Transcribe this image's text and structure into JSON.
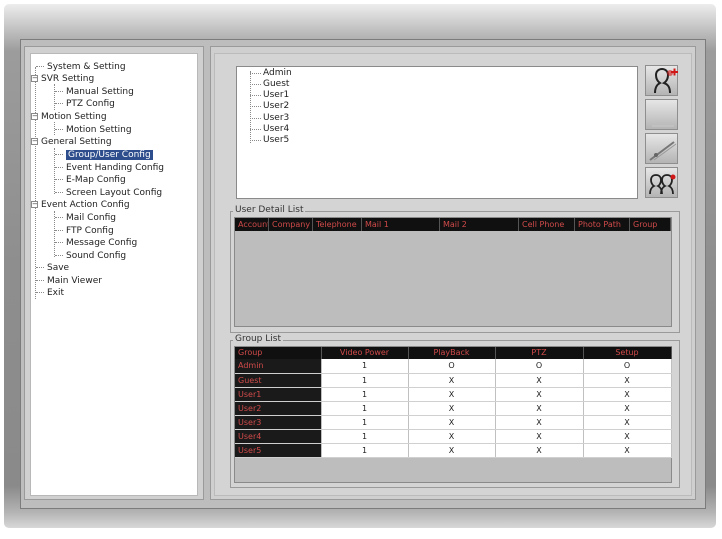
{
  "tree": {
    "items": [
      {
        "label": "System & Setting"
      },
      {
        "label": "SVR Setting"
      },
      {
        "label": "Manual Setting"
      },
      {
        "label": "PTZ Config"
      },
      {
        "label": "Motion Setting"
      },
      {
        "label": "Motion Setting"
      },
      {
        "label": "General Setting"
      },
      {
        "label": "Group/User Config"
      },
      {
        "label": "Event Handing Config"
      },
      {
        "label": "E-Map Config"
      },
      {
        "label": "Screen Layout Config"
      },
      {
        "label": "Event Action Config"
      },
      {
        "label": "Mail Config"
      },
      {
        "label": "FTP Config"
      },
      {
        "label": "Message Config"
      },
      {
        "label": "Sound Config"
      },
      {
        "label": "Save"
      },
      {
        "label": "Main Viewer"
      },
      {
        "label": "Exit"
      }
    ],
    "expand_symbol": "−",
    "selected": "Group/User Config"
  },
  "users": [
    "Admin",
    "Guest",
    "User1",
    "User2",
    "User3",
    "User4",
    "User5"
  ],
  "side_buttons": [
    {
      "icon": "add-user-icon"
    },
    {
      "icon": "blank-icon"
    },
    {
      "icon": "remove-user-icon"
    },
    {
      "icon": "group-users-icon"
    }
  ],
  "user_detail": {
    "title": "User Detail List",
    "columns": [
      "Account",
      "Company",
      "Telephone",
      "Mail 1",
      "Mail 2",
      "Cell Phone",
      "Photo Path",
      "Group"
    ]
  },
  "group_list": {
    "title": "Group List",
    "columns": [
      "Group",
      "Video Power",
      "PlayBack",
      "PTZ",
      "Setup"
    ],
    "rows": [
      [
        "Admin",
        "1",
        "O",
        "O",
        "O"
      ],
      [
        "Guest",
        "1",
        "X",
        "X",
        "X"
      ],
      [
        "User1",
        "1",
        "X",
        "X",
        "X"
      ],
      [
        "User2",
        "1",
        "X",
        "X",
        "X"
      ],
      [
        "User3",
        "1",
        "X",
        "X",
        "X"
      ],
      [
        "User4",
        "1",
        "X",
        "X",
        "X"
      ],
      [
        "User5",
        "1",
        "X",
        "X",
        "X"
      ]
    ]
  },
  "colors": {
    "selected_bg": "#2d4d8c",
    "header_bg": "#101010",
    "header_text": "#d04a4a"
  }
}
